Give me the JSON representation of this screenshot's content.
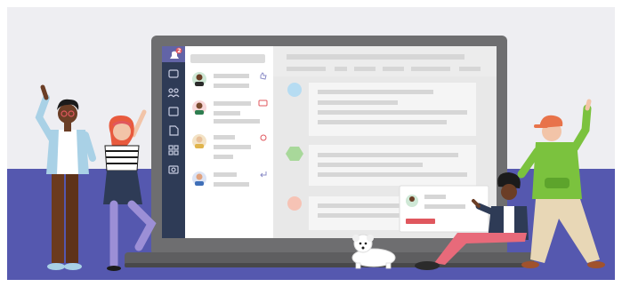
{
  "notification": {
    "count": "2"
  },
  "palette": {
    "backdrop": "#EEEEF2",
    "floor": "#5558AF",
    "laptop_frame": "#6E6E70",
    "app_rail": "#2E3B56",
    "app_rail_active": "#6264A7",
    "chat_list_bg": "#FFFFFF",
    "conversation_bg": "#E8E8E8",
    "placeholder_line": "#D6D6D6",
    "message_card": "#F5F5F5",
    "avatar_blue": "#B6DCF2",
    "avatar_green": "#A8D89A",
    "avatar_peach": "#F6C3B5",
    "alert_red": "#E0575E"
  },
  "rail_icons": [
    "activity-icon",
    "chat-icon",
    "teams-icon",
    "calendar-icon",
    "files-icon",
    "apps-icon",
    "camera-icon"
  ],
  "chat_list_status_icons": [
    "like-icon",
    "meeting-icon",
    "mention-icon",
    "reply-icon"
  ],
  "illustration_subjects": [
    "waving-person",
    "dancing-person",
    "hoodie-person",
    "sitting-person",
    "puppy"
  ]
}
